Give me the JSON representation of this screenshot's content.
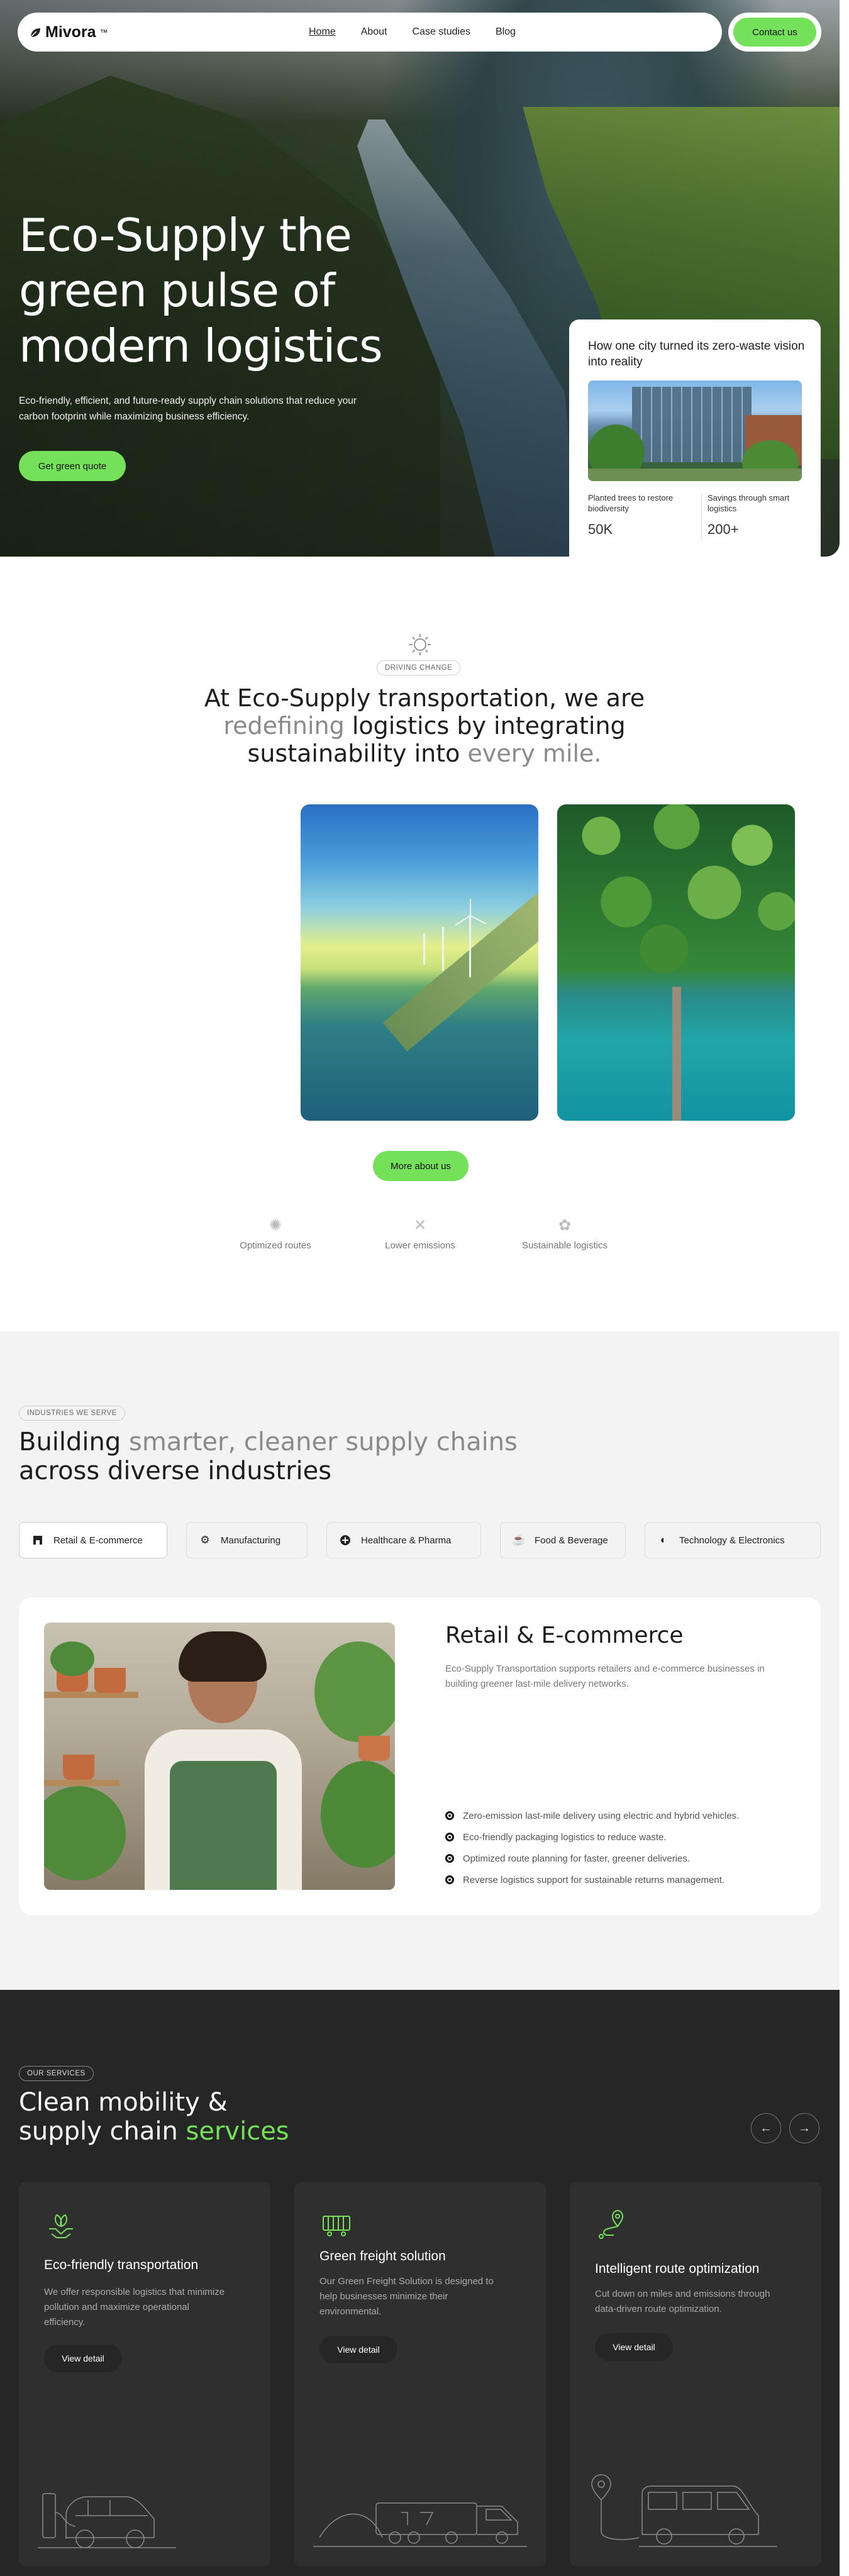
{
  "nav": {
    "brand": "Mivora",
    "trademark": "™",
    "links": [
      "Home",
      "About",
      "Case studies",
      "Blog"
    ],
    "contact_label": "Contact us"
  },
  "hero": {
    "title": "Eco-Supply the green pulse of modern logistics",
    "subtitle": "Eco-friendly, efficient, and future-ready supply chain solutions that reduce your carbon footprint while maximizing business efficiency.",
    "cta_label": "Get green quote",
    "card": {
      "title": "How one city turned its zero-waste vision into reality",
      "stats": [
        {
          "label": "Planted trees to restore biodiversity",
          "value": "50K"
        },
        {
          "label": "Savings through smart logistics",
          "value": "200+"
        }
      ]
    }
  },
  "about": {
    "pill": "DRIVING CHANGE",
    "title_parts": [
      "At Eco-Supply transportation, we are",
      "redefining",
      "logistics by integrating sustainability into",
      "every mile."
    ],
    "cta_label": "More about us",
    "features": [
      "Optimized routes",
      "Lower emissions",
      "Sustainable logistics"
    ]
  },
  "industries": {
    "pill": "INDUSTRIES WE SERVE",
    "title_parts": [
      "Building",
      "smarter, cleaner supply chains",
      "across diverse industries"
    ],
    "tabs": [
      "Retail & E-commerce",
      "Manufacturing",
      "Healthcare & Pharma",
      "Food & Beverage",
      "Technology & Electronics"
    ],
    "active": {
      "title": "Retail & E-commerce",
      "description": "Eco-Supply Transportation supports retailers and e-commerce businesses in building greener last-mile delivery networks.",
      "bullets": [
        "Zero-emission last-mile delivery using electric and hybrid vehicles.",
        "Eco-friendly packaging logistics to reduce waste.",
        "Optimized route planning for faster, greener deliveries.",
        "Reverse logistics support for sustainable returns management."
      ]
    }
  },
  "services": {
    "pill": "OUR SERVICES",
    "title_parts": [
      "Clean mobility &",
      "supply chain",
      "services"
    ],
    "prev_icon": "←",
    "next_icon": "→",
    "cards": [
      {
        "title": "Eco-friendly transportation",
        "description": "We offer responsible logistics that minimize pollution and maximize operational efficiency.",
        "cta": "View detail",
        "icon": "leaf-hands-icon"
      },
      {
        "title": "Green freight solution",
        "description": "Our Green Freight Solution is designed to help businesses minimize their environmental.",
        "cta": "View detail",
        "icon": "cargo-container-icon"
      },
      {
        "title": "Intelligent route optimization",
        "description": "Cut down on miles and emissions through data-driven route optimization.",
        "cta": "View detail",
        "icon": "route-pin-icon"
      }
    ]
  },
  "colors": {
    "accent": "#75e15a",
    "dark": "#262626",
    "light_bg": "#f3f3f3"
  }
}
